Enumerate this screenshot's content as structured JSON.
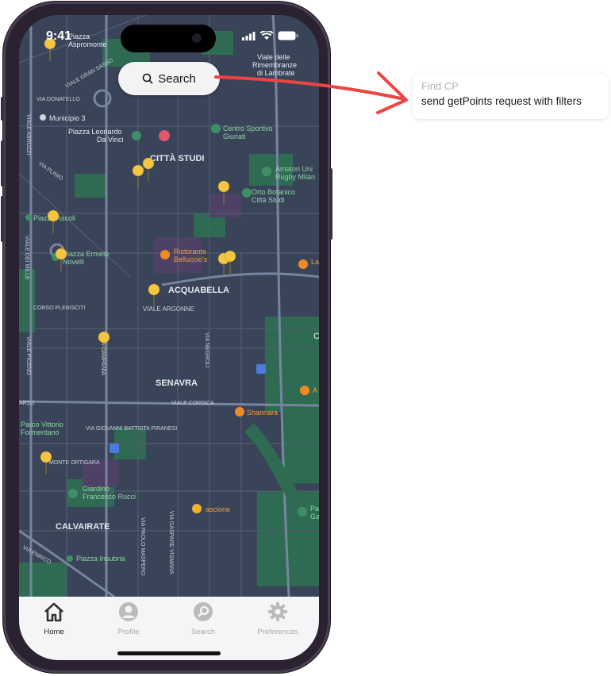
{
  "status_bar": {
    "time": "9:41"
  },
  "search_button": {
    "label": "Search"
  },
  "map": {
    "labels": {
      "piazza_aspromonte": [
        "Piazza",
        "Aspromonte"
      ],
      "viale_gran_sasso": "VIALE GRAN SASSO",
      "via_donatello": "VIA DONATELLO",
      "municipio": "Municipio 3",
      "viale_delle_rimembranze": [
        "Viale delle",
        "Rimembranze",
        "di Lambrate"
      ],
      "piazza_leonardo": [
        "Piazza Leonardo",
        "Da Vinci"
      ],
      "centro_sportivo": [
        "Centro Sportivo",
        "Giuriati"
      ],
      "citta_studi": "CITTÀ STUDI",
      "viale_abruzzi": "VIALE ABRUZZI",
      "via_plinio": "VIA PLINIO",
      "amatori": [
        "Amatori Uni",
        "Rugby Milan"
      ],
      "orto_botanico": [
        "Orto Botanico",
        "Città Studi"
      ],
      "piazza_ascoli": "Piazza Ascoli",
      "piazza_ermete": [
        "Piazza Ermete",
        "Novelli"
      ],
      "ristorante": [
        "Ristorante",
        "Belluccio's"
      ],
      "acquabella": "ACQUABELLA",
      "corso_plebisciti": "CORSO PLEBISCITI",
      "viale_argonne": "VIALE ARGONNE",
      "viale_dei_mille": "VIALE DEI MILLE",
      "viale_piceno": "VIALE PICENO",
      "via_campania": "VIA CAMPANIA",
      "via_negroli": "VIA NEGROLI",
      "senavra": "SENAVRA",
      "viale_corsica": "VIALE CORSICA",
      "arzo": "ARZO",
      "shannara": "Shannara",
      "parco_vittorio": [
        "Parco Vittorio",
        "Formentano"
      ],
      "via_piranesi": "VIA GIOVANNI BATTISTA PIRANESI",
      "monte_ortigara": "MONTE ORTIGARA",
      "giardino": [
        "Giardino",
        "Francesco Rucci"
      ],
      "ascione": "ascione",
      "calvairate": "CALVAIRATE",
      "via_maspero": "VIA PAOLO MASPERO",
      "via_vismara": "VIA GASPARE VISMARA",
      "viale_enrico": "VIA ENRICO",
      "piazza_insubria": "Piazza Insubria",
      "edge_la": "La",
      "edge_a": "A",
      "edge_c": "C",
      "edge_pa": [
        "Pa",
        "Ga"
      ]
    }
  },
  "tabbar": {
    "tabs": [
      {
        "label": "Home",
        "icon": "home-icon",
        "active": true
      },
      {
        "label": "Profile",
        "icon": "profile-icon",
        "active": false
      },
      {
        "label": "Search",
        "icon": "search-icon",
        "active": false
      },
      {
        "label": "Preferences",
        "icon": "gear-icon",
        "active": false
      }
    ]
  },
  "annotation": {
    "title": "Find CP",
    "description": "send getPoints request with filters",
    "arrow_color": "#ee4444"
  },
  "colors": {
    "map_base": "#3a4458",
    "park": "#2f6b52",
    "pin": "#f4c542",
    "poi_orange": "#f08a24",
    "poi_green": "#3f8f66"
  }
}
